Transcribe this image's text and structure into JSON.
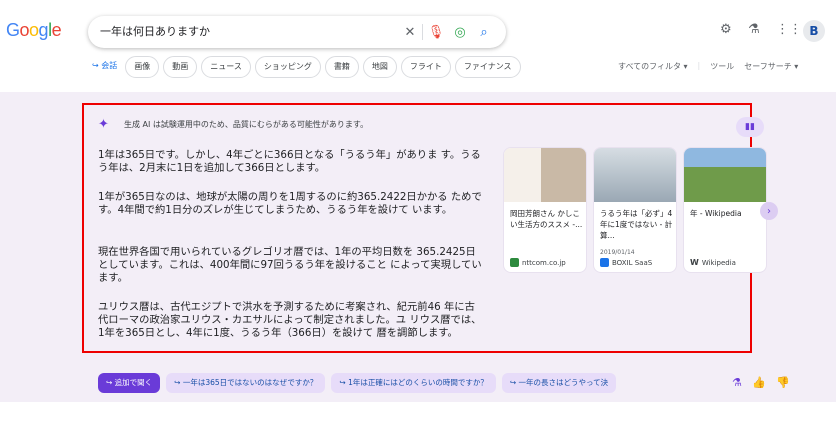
{
  "logo": {
    "text": "Google"
  },
  "search": {
    "query": "一年は何日ありますか"
  },
  "header": {
    "avatar": "B"
  },
  "chips": [
    "会話",
    "画像",
    "動画",
    "ニュース",
    "ショッピング",
    "書籍",
    "地図",
    "フライト",
    "ファイナンス"
  ],
  "filters": {
    "all_filters": "すべてのフィルタ ▾",
    "tools": "ツール",
    "safe_search": "セーフサーチ ▾"
  },
  "ai": {
    "badge": "生成 AI は試験運用中のため、品質にむらがある可能性があります。",
    "paragraphs": [
      "1年は365日です。しかし、4年ごとに366日となる「うるう年」がありま す。うるう年は、2月末に1日を追加して366日とします。",
      "1年が365日なのは、地球が太陽の周りを1周するのに約365.2422日かかる ためです。4年間で約1日分のズレが生じてしまうため、うるう年を設けて います。",
      "現在世界各国で用いられているグレゴリオ暦では、1年の平均日数を 365.2425日としています。これは、400年間に97回うるう年を設けること によって実現しています。",
      "ユリウス暦は、古代エジプトで洪水を予測するために考案され、紀元前46 年に古代ローマの政治家ユリウス・カエサルによって制定されました。ユ リウス暦では、1年を365日とし、4年に1度、うるう年（366日）を設けて 暦を調節します。"
    ],
    "cards": [
      {
        "title": "岡田芳朗さん かしこい生活方のススメ -...",
        "date": "",
        "source": "nttcom.co.jp",
        "img_color": "#c9b9a6",
        "src_color": "#2d8a3e"
      },
      {
        "title": "うるう年は「必ず」4年に1度ではない - 計算...",
        "date": "2019/01/14",
        "source": "BOXIL SaaS",
        "img_color": "#b7c2cc",
        "src_color": "#1a73e8"
      },
      {
        "title": "年 - Wikipedia",
        "date": "",
        "source": "Wikipedia",
        "img_color": "#6f9b4a",
        "src_color": "#ffffff"
      }
    ]
  },
  "followups": [
    "追加で聞く",
    "一年は365日ではないのはなぜですか？",
    "1年は正確にはどのくらいの時間ですか？",
    "一年の長さはどうやって決"
  ],
  "colors": {
    "accent": "#6a3bd8",
    "highlight_border": "#e00000",
    "panel_bg": "#f3eef7"
  }
}
